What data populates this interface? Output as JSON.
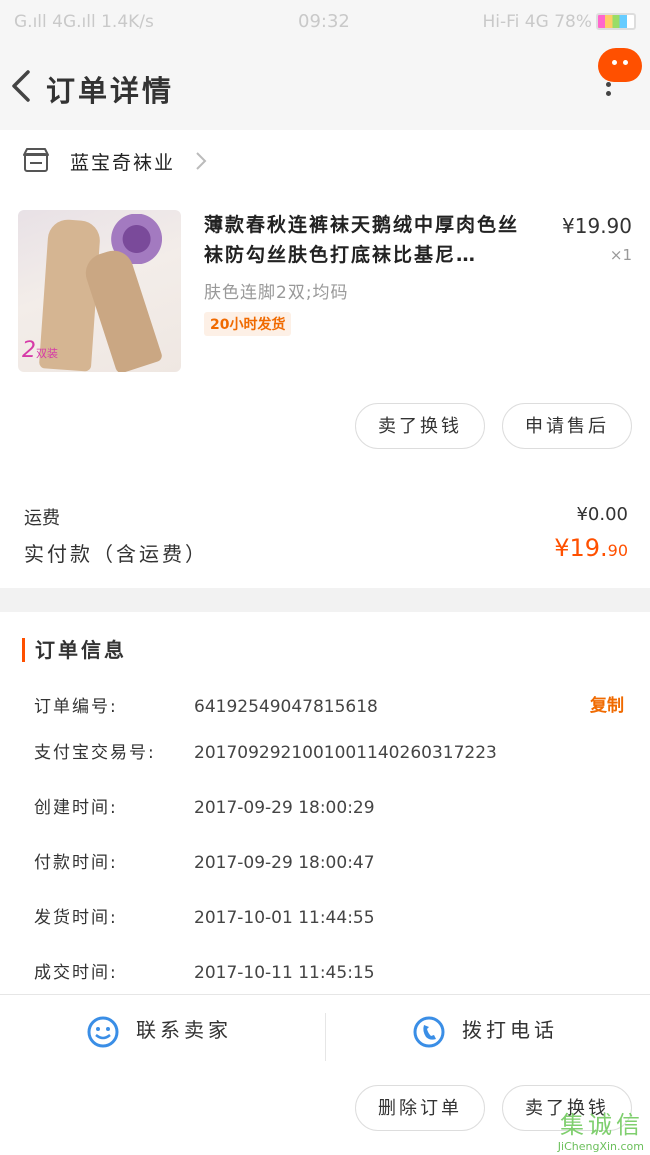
{
  "status_bar": {
    "left": "G.ıll 4G.ıll 1.4K/s",
    "time": "09:32",
    "right": "Hi-Fi 4G 78%"
  },
  "header": {
    "title": "订单详情"
  },
  "shop": {
    "name": "蓝宝奇袜业"
  },
  "product": {
    "title": "薄款春秋连裤袜天鹅绒中厚肉色丝袜防勾丝肤色打底袜比基尼…",
    "price": "¥19.90",
    "quantity": "×1",
    "sku": "肤色连脚2双;均码",
    "ship_tag": "20小时发货",
    "image_badge": "2",
    "image_badge_suffix": "双装",
    "sell_button": "卖了换钱",
    "aftersale_button": "申请售后"
  },
  "totals": {
    "shipping_label": "运费",
    "shipping_value": "¥0.00",
    "paid_label": "实付款（含运费）",
    "paid_value_main": "¥19.",
    "paid_value_decimal": "90"
  },
  "order_info": {
    "title": "订单信息",
    "copy_label": "复制",
    "rows": [
      {
        "key": "订单编号:",
        "value": "64192549047815618"
      },
      {
        "key": "支付宝交易号:",
        "value": "2017092921001001140260317223"
      },
      {
        "key": "创建时间:",
        "value": "2017-09-29 18:00:29"
      },
      {
        "key": "付款时间:",
        "value": "2017-09-29 18:00:47"
      },
      {
        "key": "发货时间:",
        "value": "2017-10-01 11:44:55"
      },
      {
        "key": "成交时间:",
        "value": "2017-10-11 11:45:15"
      }
    ]
  },
  "contact": {
    "seller_label": "联系卖家",
    "phone_label": "拨打电话"
  },
  "footer": {
    "delete_button": "删除订单",
    "sell_button": "卖了换钱"
  },
  "watermark": {
    "title": "集诚信",
    "url": "JiChengXin.com"
  },
  "colors": {
    "accent": "#ff5000",
    "copy": "#f06a00",
    "contact_icon": "#3a8ee6"
  }
}
